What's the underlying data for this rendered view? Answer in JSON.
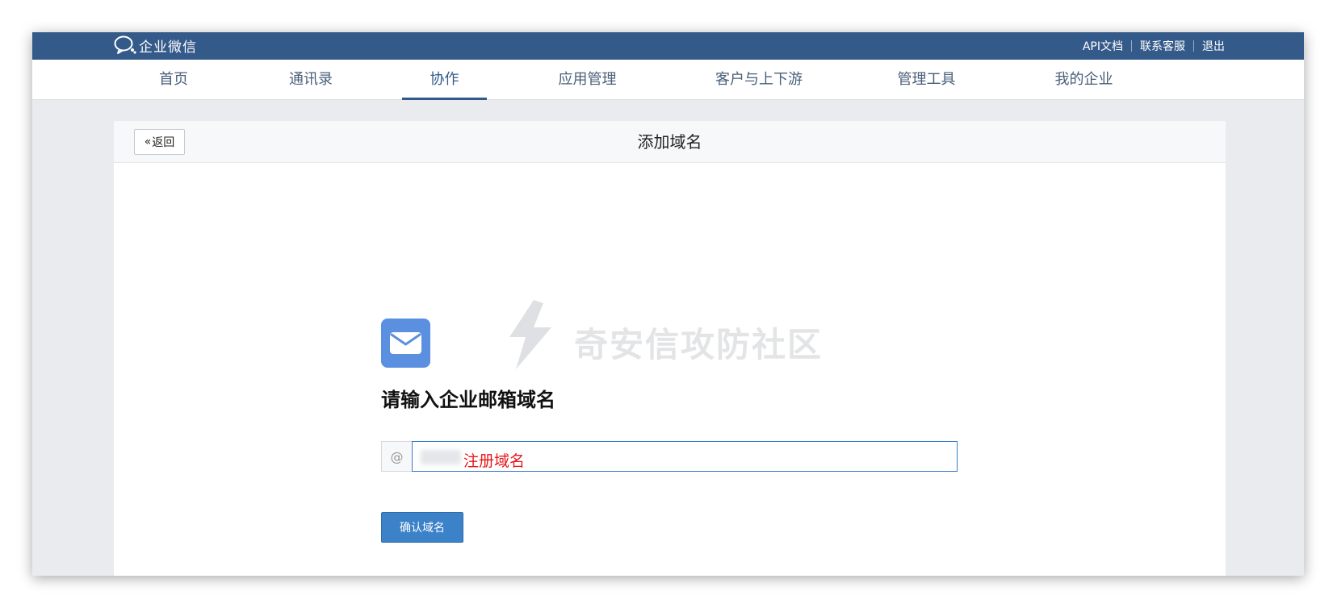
{
  "app": {
    "logo_text": "企业微信"
  },
  "toplinks": [
    "API文档",
    "联系客服",
    "退出"
  ],
  "nav": {
    "tabs": [
      {
        "label": "首页"
      },
      {
        "label": "通讯录"
      },
      {
        "label": "协作",
        "active": true
      },
      {
        "label": "应用管理"
      },
      {
        "label": "客户与上下游"
      },
      {
        "label": "管理工具"
      },
      {
        "label": "我的企业"
      }
    ]
  },
  "page": {
    "back_label": "返回",
    "title": "添加域名",
    "heading": "请输入企业邮箱域名",
    "input_prefix": "@",
    "input_annotation": "注册域名",
    "confirm_label": "确认域名",
    "watermark": "奇安信攻防社区"
  },
  "icons": {
    "mail": "mail-icon",
    "logo": "wecom-logo-icon",
    "back": "double-chevron-left-icon",
    "watermark": "lightning-logo-icon"
  },
  "colors": {
    "header": "#345a8a",
    "accent": "#3b82c8",
    "mail_icon": "#5b8fe0",
    "annotation": "#e8161a"
  }
}
